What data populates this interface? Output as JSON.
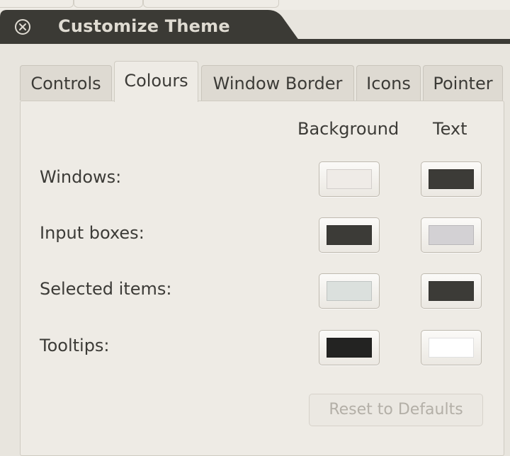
{
  "window": {
    "title": "Customize Theme"
  },
  "tabs": [
    {
      "label": "Controls",
      "active": false
    },
    {
      "label": "Colours",
      "active": true
    },
    {
      "label": "Window Border",
      "active": false
    },
    {
      "label": "Icons",
      "active": false
    },
    {
      "label": "Pointer",
      "active": false
    }
  ],
  "colours_tab": {
    "headers": {
      "background": "Background",
      "text": "Text"
    },
    "rows": [
      {
        "label": "Windows:",
        "background_color": "#efebe7",
        "text_color": "#3c3b37"
      },
      {
        "label": "Input boxes:",
        "background_color": "#3c3b37",
        "text_color": "#d3d1d4"
      },
      {
        "label": "Selected items:",
        "background_color": "#dbe0dd",
        "text_color": "#3c3b37"
      },
      {
        "label": "Tooltips:",
        "background_color": "#232322",
        "text_color": "#ffffff"
      }
    ],
    "reset_button": {
      "label": "Reset to Defaults",
      "enabled": false
    }
  },
  "theme": {
    "titlebar_color": "#3b3a35",
    "title_text_color": "#dfdbd2",
    "page_background": "#eeebe5"
  }
}
